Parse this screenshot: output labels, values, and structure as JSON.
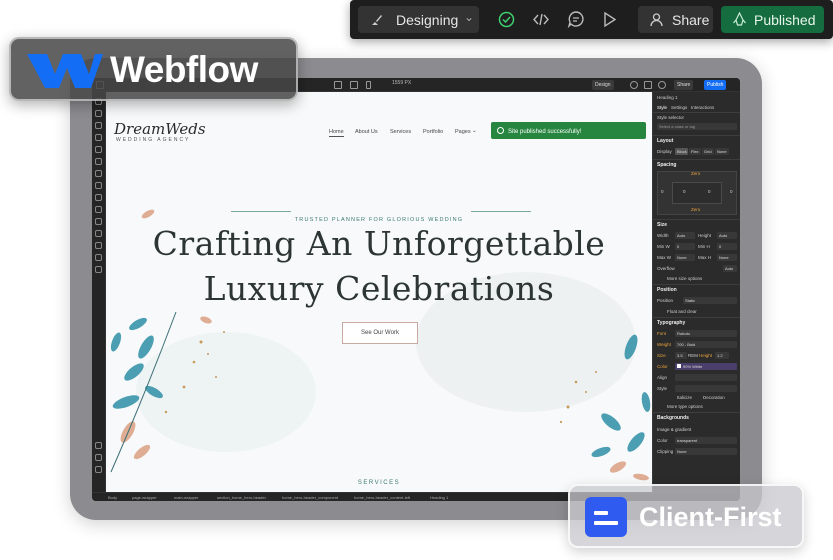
{
  "toolbar": {
    "mode_label": "Designing",
    "share_label": "Share",
    "publish_label": "Published"
  },
  "badges": {
    "webflow": "Webflow",
    "client_first": "Client-First"
  },
  "designer": {
    "top": {
      "width_readout": "1559 PX",
      "design_label": "Design",
      "share_label": "Share",
      "publish_label": "Publish"
    },
    "breadcrumbs": [
      "Body",
      "page-wrapper",
      "main-wrapper",
      "section_home_hero-header",
      "home_hero-header_component",
      "home_hero-header_content-left",
      "Heading 1"
    ],
    "right_panel": {
      "element": "Heading 1",
      "tabs": [
        "Style",
        "Settings",
        "Interactions"
      ],
      "style_selector_label": "Style selector",
      "class_placeholder": "Select a class or tag",
      "layout": "Layout",
      "display_label": "Display",
      "display_options": [
        "Block",
        "Flex",
        "Grid",
        "None"
      ],
      "spacing": "Spacing",
      "spacing_values": [
        "Zero",
        "0",
        "0",
        "0",
        "0",
        "Zero"
      ],
      "size": "Size",
      "size_rows": [
        [
          "Width",
          "Auto",
          "Height",
          "Auto"
        ],
        [
          "Min W",
          "0",
          "Min H",
          "0"
        ],
        [
          "Max W",
          "None",
          "Max H",
          "None"
        ]
      ],
      "overflow_label": "Overflow",
      "overflow_auto": "Auto",
      "more_size": "More size options",
      "position": "Position",
      "position_label": "Position",
      "position_value": "Static",
      "float_clear": "Float and clear",
      "typography": "Typography",
      "font_label": "Font",
      "font_value": "Roboto",
      "weight_label": "Weight",
      "weight_value": "700 - Bold",
      "size_label": "Size",
      "size_value": "3.5",
      "size_unit": "REM",
      "height_label": "Height",
      "height_value": "1.2",
      "color_label": "Color",
      "color_value": "90% White",
      "align_label": "Align",
      "style_label": "Style",
      "italicize": "Italicize",
      "decoration": "Decoration",
      "more_type": "More type options",
      "backgrounds": "Backgrounds",
      "image_gradient": "Image & gradient",
      "bg_color_label": "Color",
      "bg_color_value": "transparent",
      "clipping_label": "Clipping",
      "clipping_value": "None"
    }
  },
  "site": {
    "logo": "DreamWeds",
    "logo_sub": "WEDDING AGENCY",
    "nav": [
      "Home",
      "About Us",
      "Services",
      "Portfolio",
      "Pages"
    ],
    "toast": "Site published successfully!",
    "tagline": "TRUSTED PLANNER FOR GLORIOUS WEDDING",
    "heading_line1": "Crafting An Unforgettable",
    "heading_line2": "Luxury Celebrations",
    "cta": "See Our Work",
    "section_label": "SERVICES"
  },
  "colors": {
    "publish_green": "#146c3f",
    "toast_green": "#26853f",
    "webflow_blue": "#146ef5",
    "client_first_blue": "#2f5bf0",
    "heading": "#2c3534",
    "accent_teal": "#3d7a6e"
  }
}
